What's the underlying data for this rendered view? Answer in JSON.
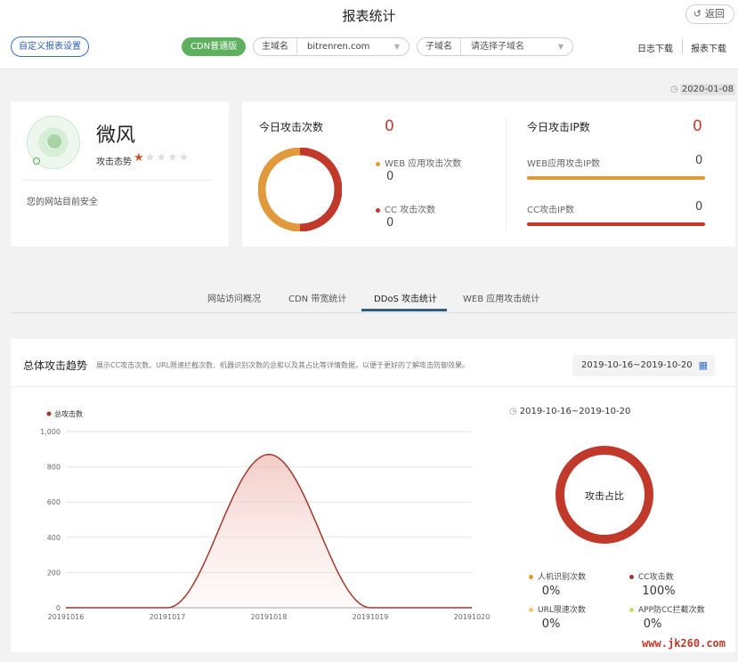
{
  "header": {
    "title": "报表统计",
    "back_label": "返回",
    "custom_report_label": "自定义报表设置",
    "cdn_badge": "CDN普通版",
    "main_domain_label": "主域名",
    "main_domain_value": "bitrenren.com",
    "sub_domain_label": "子域名",
    "sub_domain_placeholder": "请选择子域名",
    "log_download": "日志下载",
    "report_download": "报表下载"
  },
  "date_tag": "2020-01-08",
  "profile": {
    "name": "微风",
    "attack_level_label": "攻击态势",
    "stars_filled": 1,
    "stars_total": 5,
    "status_text": "您的网站目前安全"
  },
  "stats": {
    "today_attacks_title": "今日攻击次数",
    "today_attacks_value": "0",
    "web_attacks_label": "WEB 应用攻击次数",
    "web_attacks_value": "0",
    "cc_attacks_label": "CC 攻击次数",
    "cc_attacks_value": "0",
    "today_ip_title": "今日攻击IP数",
    "today_ip_value": "0",
    "web_ip_label": "WEB应用攻击IP数",
    "web_ip_value": "0",
    "cc_ip_label": "CC攻击IP数",
    "cc_ip_value": "0",
    "colors": {
      "web": "#e09a3b",
      "cc": "#c0392b"
    }
  },
  "tabs": [
    {
      "label": "网站访问概况"
    },
    {
      "label": "CDN 带宽统计"
    },
    {
      "label": "DDoS 攻击统计",
      "active": true
    },
    {
      "label": "WEB 应用攻击统计"
    }
  ],
  "trend": {
    "title": "总体攻击趋势",
    "description": "展示CC攻击次数、URL限速拦截次数、机器识别次数的总和以及其占比等详情数据，以便于更好的了解攻击防御效果。",
    "date_range": "2019-10-16~2019-10-20",
    "pie": {
      "date_range": "2019-10-16~2019-10-20",
      "center_label": "攻击占比",
      "legend": [
        {
          "label": "人机识别次数",
          "value": "0%",
          "color": "#e09a3b"
        },
        {
          "label": "CC攻击数",
          "value": "100%",
          "color": "#a0392b"
        },
        {
          "label": "URL限速次数",
          "value": "0%",
          "color": "#f0c96a"
        },
        {
          "label": "APP防CC拦截次数",
          "value": "0%",
          "color": "#c6dd6a"
        }
      ]
    }
  },
  "chart_data": {
    "type": "area",
    "legend": [
      {
        "name": "总攻击数",
        "color": "#a0392b"
      }
    ],
    "x": [
      "20191016",
      "20191017",
      "20191018",
      "20191019",
      "20191020"
    ],
    "series": [
      {
        "name": "总攻击数",
        "values": [
          0,
          0,
          870,
          0,
          0
        ]
      }
    ],
    "yticks": [
      "0",
      "200",
      "400",
      "600",
      "800",
      "1,000"
    ],
    "ylim": [
      0,
      1000
    ],
    "grid": true,
    "legend_position": "top-left"
  },
  "watermark": "www.jk260.com"
}
